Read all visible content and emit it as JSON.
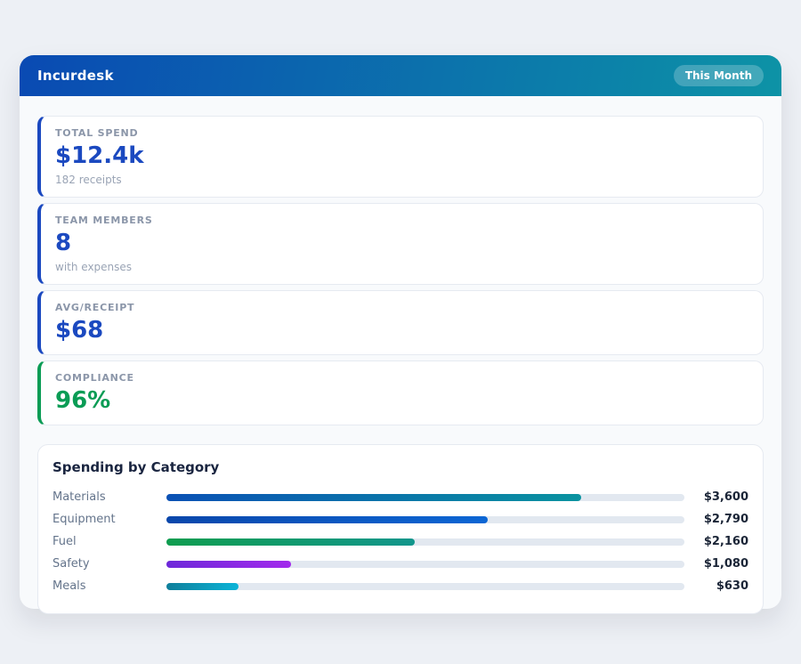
{
  "header": {
    "title": "Incurdesk",
    "badge_label": "This Month",
    "gradient": [
      "#0a4ab3",
      "#0d93a6"
    ]
  },
  "stats": [
    {
      "label": "TOTAL SPEND",
      "value": "$12.4k",
      "sub": "182 receipts",
      "accent": "#1b49c0"
    },
    {
      "label": "TEAM MEMBERS",
      "value": "8",
      "sub": "with expenses",
      "accent": "#1b49c0"
    },
    {
      "label": "AVG/RECEIPT",
      "value": "$68",
      "sub": "",
      "accent": "#1b49c0"
    },
    {
      "label": "COMPLIANCE",
      "value": "96%",
      "sub": "",
      "accent": "#0a9c55"
    }
  ],
  "chart_data": {
    "type": "bar",
    "orientation": "horizontal",
    "title": "Spending by Category",
    "categories": [
      "Materials",
      "Equipment",
      "Fuel",
      "Safety",
      "Meals"
    ],
    "values": [
      3600,
      2790,
      2160,
      1080,
      630
    ],
    "value_labels": [
      "$3,600",
      "$2,790",
      "$2,160",
      "$1,080",
      "$630"
    ],
    "xlim": [
      0,
      4500
    ],
    "grid": false,
    "legend": false,
    "track_color": "#e2e8f0",
    "bar_gradients": [
      [
        "#0b51b5",
        "#0a93a0"
      ],
      [
        "#0a47ab",
        "#0c66d4"
      ],
      [
        "#0f9d4f",
        "#12968c"
      ],
      [
        "#6d28d9",
        "#a229ec"
      ],
      [
        "#0e7f9b",
        "#0cb4d8"
      ]
    ]
  }
}
